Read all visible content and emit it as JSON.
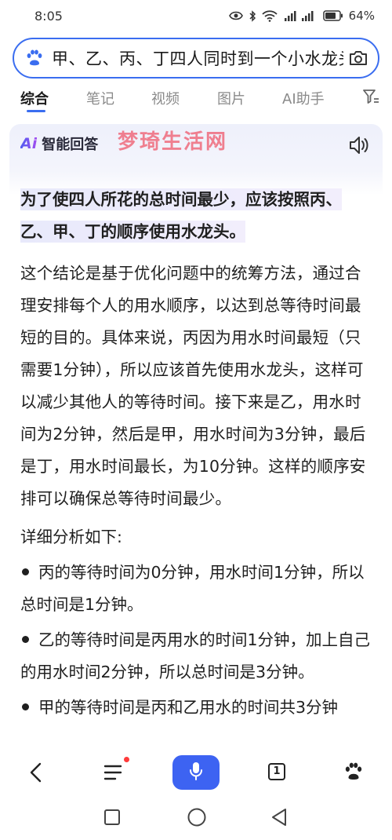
{
  "status_bar": {
    "time": "8:05",
    "battery_percent": "64%",
    "icons": [
      "eye-icon",
      "bluetooth-icon",
      "wifi-icon",
      "signal-4g-icon",
      "battery-icon"
    ]
  },
  "search": {
    "query": "甲、乙、丙、丁四人同时到一个小水龙头处打水"
  },
  "tabs": [
    {
      "label": "综合",
      "active": true
    },
    {
      "label": "笔记",
      "active": false
    },
    {
      "label": "视频",
      "active": false
    },
    {
      "label": "图片",
      "active": false
    },
    {
      "label": "AI助手",
      "active": false
    }
  ],
  "ai_card": {
    "logo": "Ai",
    "title": "智能回答",
    "watermark": "梦琦生活网",
    "summary": "为了使四人所花的总时间最少，应该按照丙、乙、甲、丁的顺序使用水龙头。",
    "paragraph": "这个结论是基于优化问题中的统筹方法，通过合理安排每个人的用水顺序，以达到总等待时间最短的目的。具体来说，丙因为用水时间最短（只需要1分钟），所以应该首先使用水龙头，这样可以减少其他人的等待时间。接下来是乙，用水时间为2分钟，然后是甲，用水时间为3分钟，最后是丁，用水时间最长，为10分钟。这样的顺序安排可以确保总等待时间最少。",
    "subheading": "详细分析如下:",
    "bullets": [
      "丙的等待时间为0分钟，用水时间1分钟，所以总时间是1分钟。",
      "乙的等待时间是丙用水的时间1分钟，加上自己的用水时间2分钟，所以总时间是3分钟。",
      "甲的等待时间是丙和乙用水的时间共3分钟"
    ]
  },
  "toolbar": {
    "tab_count": "1",
    "icons": [
      "back-icon",
      "menu-icon",
      "microphone-icon",
      "tab-count-icon",
      "baidu-paw-icon"
    ]
  },
  "system_nav": {
    "icons": [
      "recent-apps-icon",
      "home-icon",
      "back-triangle-icon"
    ]
  },
  "colors": {
    "accent": "#3d63f2",
    "search_border": "#3a6df0",
    "watermark": "#ef6b7d",
    "notification_dot": "#ff3b3b"
  }
}
